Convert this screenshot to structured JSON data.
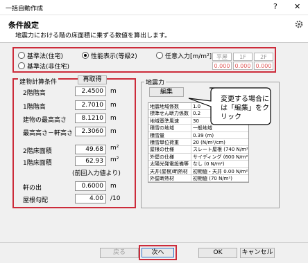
{
  "window": {
    "title": "一括自動作成",
    "help_button": "?",
    "close_button": "✕"
  },
  "header": {
    "title": "条件設定",
    "subtitle": "地震力における階の床面積に乗ずる数値を算出します。"
  },
  "criteria": {
    "options": [
      {
        "label": "基準法(住宅)",
        "selected": false
      },
      {
        "label": "性能表示(等級2)",
        "selected": true
      },
      {
        "label": "任意入力[m/m²]",
        "selected": false
      },
      {
        "label": "基準法(非住宅)",
        "selected": false
      }
    ],
    "mini_table": {
      "headers": [
        "平屋",
        "1F",
        "2F"
      ],
      "values": [
        "0.000",
        "0.000",
        "0.000"
      ]
    }
  },
  "building": {
    "group_title": "建物計算条件",
    "reload_button": "再取得",
    "fields": [
      {
        "label": "2階階高",
        "value": "2.4500",
        "unit": "m"
      },
      {
        "label": "1階階高",
        "value": "2.7010",
        "unit": "m"
      },
      {
        "label": "建物の最高高さ",
        "value": "8.1210",
        "unit": "m"
      },
      {
        "label": "最高高さ－軒高さ",
        "value": "2.3060",
        "unit": "m"
      },
      {
        "label": "2階床面積",
        "value": "49.68",
        "unit": "m²"
      },
      {
        "label": "1階床面積",
        "value": "62.93",
        "unit": "m²"
      },
      {
        "label": "軒の出",
        "value": "0.6000",
        "unit": "m"
      },
      {
        "label": "屋根勾配",
        "value": "4.00",
        "unit": "/10"
      }
    ],
    "note": "(前回入力値より)"
  },
  "seismic": {
    "group_title": "地震力",
    "edit_button": "編集",
    "callout": "変更する場合には「編集」をクリック",
    "rows": [
      {
        "key": "地震地域係数",
        "value": "1.0"
      },
      {
        "key": "標準せん断力係数",
        "value": "0.2"
      },
      {
        "key": "地域基準風速",
        "value": "30"
      },
      {
        "key": "積雪の地域",
        "value": "一般地域"
      },
      {
        "key": "積雪量",
        "value": "0.39 (m)"
      },
      {
        "key": "積雪単位荷重",
        "value": "20 (N/m²/cm)"
      },
      {
        "key": "屋根の仕様",
        "value": "スレート屋根 (740 N/m²)"
      },
      {
        "key": "外壁の仕様",
        "value": "サイディング (600 N/m²)"
      },
      {
        "key": "太陽光発電設備等",
        "value": "なし (0 N/m²)"
      },
      {
        "key": "天井(屋根)断熱材",
        "value": "初期値・天井 0.00 N/m²)"
      },
      {
        "key": "外壁断熱材",
        "value": "初期値 (70 N/m²)"
      }
    ]
  },
  "footer": {
    "back": "戻る",
    "next": "次へ",
    "ok": "OK",
    "cancel": "キャンセル"
  },
  "colors": {
    "highlight_border": "#cc2b3a",
    "callout_border": "#000000"
  }
}
